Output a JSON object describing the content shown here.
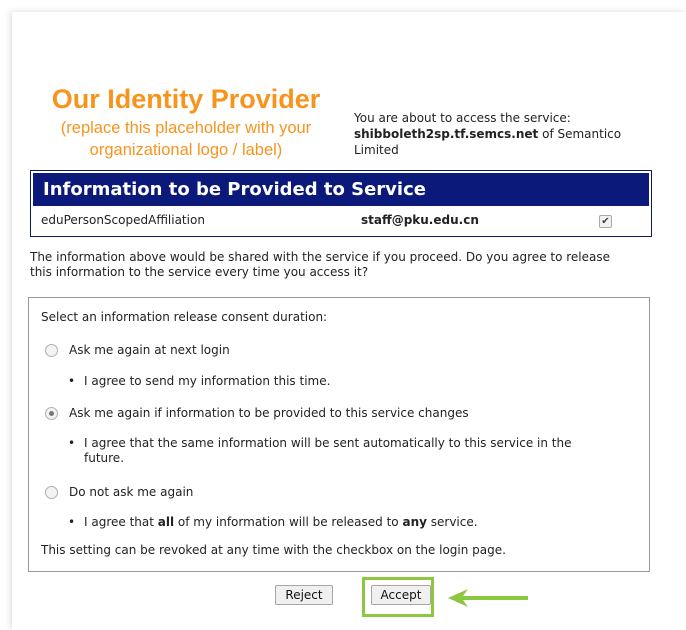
{
  "logo": {
    "title": "Our Identity Provider",
    "subtitle_line1": "(replace this placeholder with your",
    "subtitle_line2": "organizational logo / label)"
  },
  "service": {
    "intro": "You are about to access the service:",
    "host": "shibboleth2sp.tf.semcs.net",
    "of_text": " of Semantico",
    "org_line2": "Limited"
  },
  "info_table": {
    "header": "Information to be Provided to Service",
    "rows": [
      {
        "name": "eduPersonScopedAffiliation",
        "value": "staff@pku.edu.cn",
        "checked": true
      }
    ]
  },
  "question": {
    "line1": "The information above would be shared with the service if you proceed. Do you agree to release",
    "line2": "this information to the service every time you access it?"
  },
  "consent": {
    "prompt": "Select an information release consent duration:",
    "options": [
      {
        "label": "Ask me again at next login",
        "selected": false,
        "bullet": "I agree to send my information this time."
      },
      {
        "label": "Ask me again if information to be provided to this service changes",
        "selected": true,
        "bullet_line1": "I agree that the same information will be sent automatically to this service in the",
        "bullet_line2": "future."
      },
      {
        "label": "Do not ask me again",
        "selected": false,
        "bullet_pre": "I agree that ",
        "bullet_b1": "all",
        "bullet_mid": " of my information will be released to ",
        "bullet_b2": "any",
        "bullet_post": " service."
      }
    ],
    "footer": "This setting can be revoked at any time with the checkbox on the login page."
  },
  "buttons": {
    "reject": "Reject",
    "accept": "Accept"
  },
  "colors": {
    "brand_orange": "#f7941d",
    "header_navy": "#0b1a7a",
    "highlight_green": "#8dc63f"
  },
  "icons": {
    "check": "check-icon",
    "arrow": "arrow-left-icon"
  }
}
